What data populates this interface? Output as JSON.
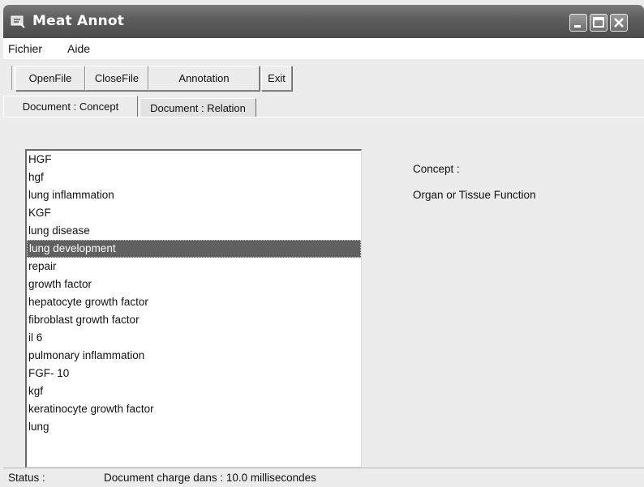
{
  "window": {
    "title": "Meat Annot"
  },
  "menu": [
    "Fichier",
    "Aide"
  ],
  "toolbar": {
    "open_label": "OpenFile",
    "close_label": "CloseFile",
    "annotation_label": "Annotation",
    "exit_label": "Exit"
  },
  "tabs": [
    {
      "label": "Document : Concept",
      "active": true
    },
    {
      "label": "Document : Relation",
      "active": false
    }
  ],
  "concepts": {
    "items": [
      "HGF",
      "hgf",
      "lung inflammation",
      "KGF",
      "lung disease",
      "lung development",
      "repair",
      "growth factor",
      "hepatocyte growth factor",
      "fibroblast growth factor",
      "il 6",
      "pulmonary inflammation",
      "FGF- 10",
      "kgf",
      "keratinocyte growth factor",
      "lung"
    ],
    "selected": "lung development"
  },
  "detail": {
    "label": "Concept :",
    "value": "Organ or Tissue Function"
  },
  "status": {
    "label": "Status :",
    "text": "Document charge dans : 10.0 millisecondes"
  },
  "icons": {
    "app": "app-icon",
    "minimize": "minimize-icon",
    "maximize": "maximize-icon",
    "close": "close-icon"
  }
}
